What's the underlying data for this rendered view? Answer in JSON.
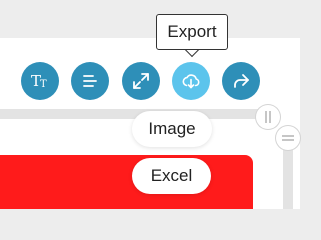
{
  "tooltip": {
    "text": "Export"
  },
  "toolbar": {
    "buttons": [
      {
        "name": "text-style",
        "icon": "text-size-icon"
      },
      {
        "name": "align",
        "icon": "align-left-icon"
      },
      {
        "name": "expand",
        "icon": "expand-icon"
      },
      {
        "name": "export",
        "icon": "download-cloud-icon",
        "active": true
      },
      {
        "name": "share",
        "icon": "share-arrow-icon"
      }
    ],
    "colors": {
      "button": "#2e8fb8",
      "active": "#5cc4ec"
    }
  },
  "export_menu": {
    "items": [
      {
        "label": "Image"
      },
      {
        "label": "Excel"
      }
    ]
  },
  "content": {
    "accent": "#ff1b1b"
  }
}
